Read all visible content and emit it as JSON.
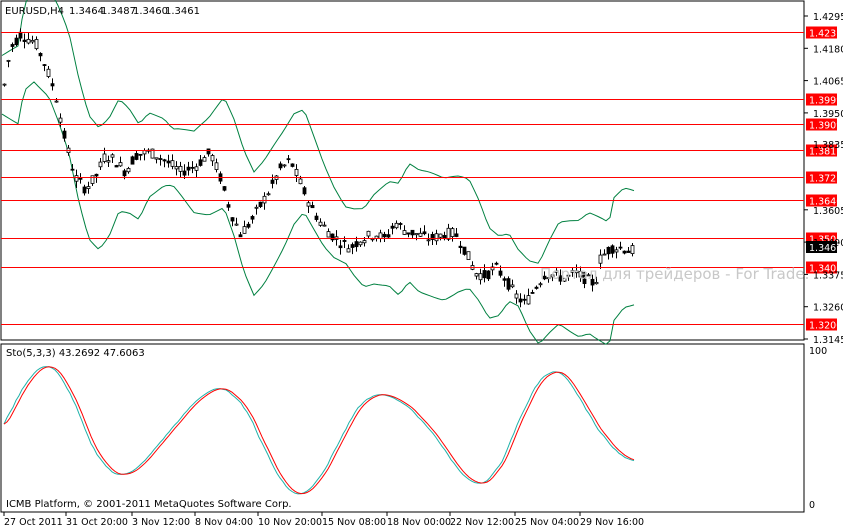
{
  "header": {
    "symbol": "EURUSD,H4",
    "open": "1.3464",
    "high": "1.3487",
    "low": "1.3460",
    "close": "1.3461"
  },
  "price_axis": {
    "ticks": [
      "1.4295",
      "1.4180",
      "1.4065",
      "1.3950",
      "1.3605",
      "1.3490",
      "1.3375",
      "1.3260",
      "1.3145"
    ],
    "partial_tick": "1.3835",
    "current_price": "1.3461"
  },
  "levels": [
    "1.4237",
    "1.3999",
    "1.3909",
    "1.3817",
    "1.3722",
    "1.3640",
    "1.3504",
    "1.3401",
    "1.3200"
  ],
  "watermark": "Портал для трейдеров  -  For Trade.",
  "indicator": {
    "title": "Sto(5,3,3) 43.2692 47.6063",
    "axis_top": "100",
    "axis_bottom": "0"
  },
  "copyright": "ICMB Platform, © 2001-2011 MetaQuotes Software Corp.",
  "time_axis": [
    "27 Oct 2011",
    "31 Oct 20:00",
    "3 Nov 12:00",
    "8 Nov 04:00",
    "10 Nov 20:00",
    "15 Nov 08:00",
    "18 Nov 00:00",
    "22 Nov 12:00",
    "25 Nov 04:00",
    "29 Nov 16:00"
  ],
  "colors": {
    "level_line": "#ff0000",
    "level_label_bg": "#ff0000",
    "current_price_bg": "#000000",
    "bollinger": "#008040",
    "stoch_main": "#20b2aa",
    "stoch_signal": "#ff0000",
    "candle": "#000000"
  }
}
